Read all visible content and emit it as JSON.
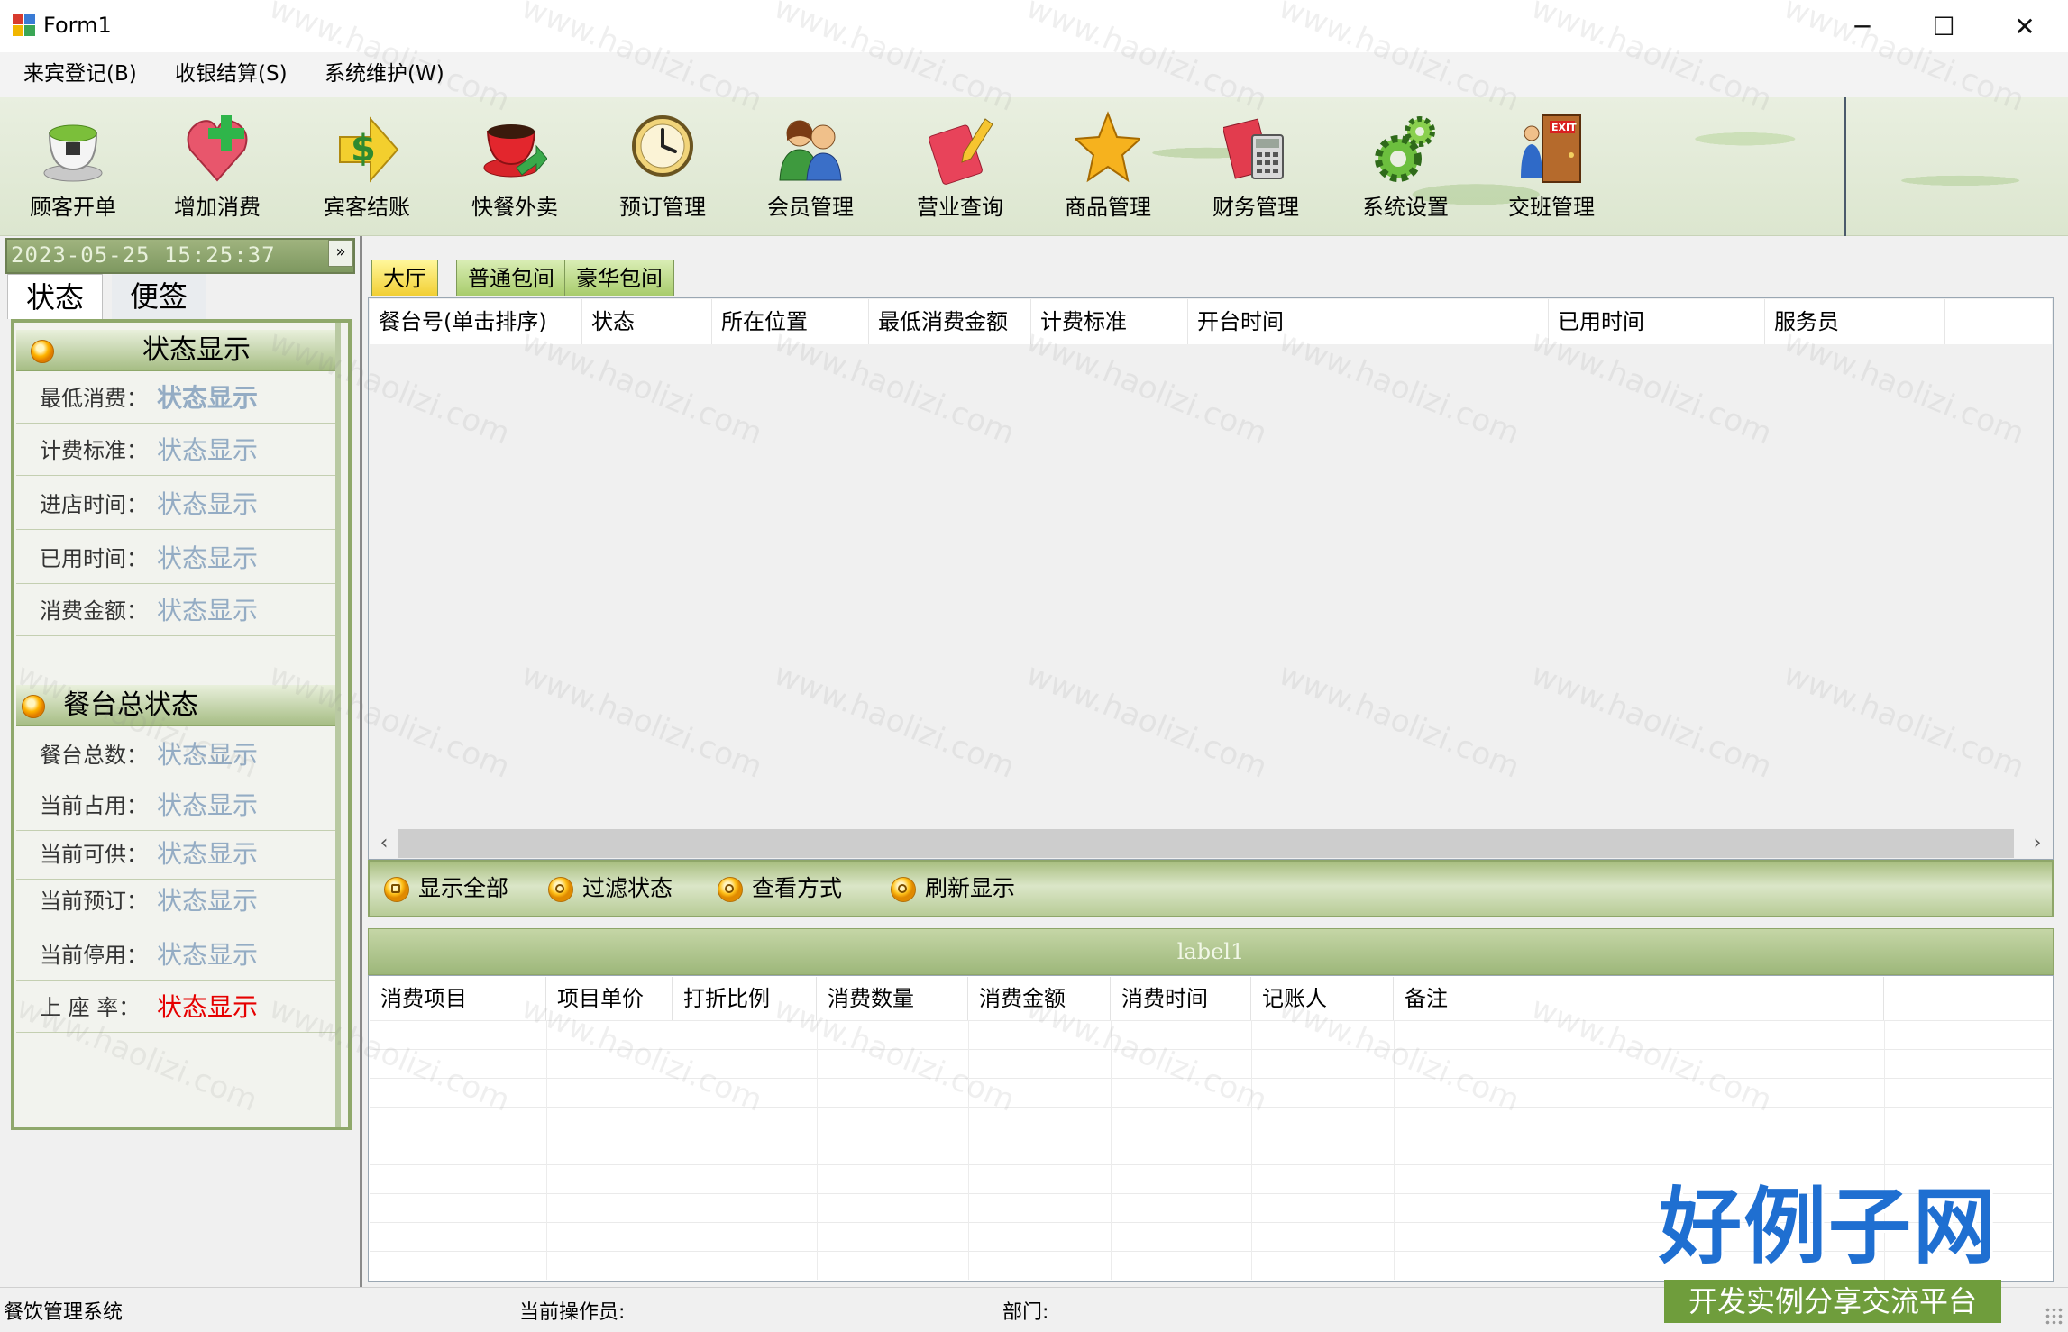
{
  "window": {
    "title": "Form1",
    "controls": [
      "─",
      "☐",
      "✕"
    ]
  },
  "menu": [
    {
      "label": "来宾登记(B)"
    },
    {
      "label": "收银结算(S)"
    },
    {
      "label": "系统维护(W)"
    }
  ],
  "toolbar": [
    {
      "label": "顾客开单",
      "icon": "teacup-icon"
    },
    {
      "label": "增加消费",
      "icon": "add-heart-icon"
    },
    {
      "label": "宾客结账",
      "icon": "dollar-arrow-icon"
    },
    {
      "label": "快餐外卖",
      "icon": "coffee-cup-icon"
    },
    {
      "label": "预订管理",
      "icon": "clock-icon"
    },
    {
      "label": "会员管理",
      "icon": "members-icon"
    },
    {
      "label": "营业查询",
      "icon": "notebook-pencil-icon"
    },
    {
      "label": "商品管理",
      "icon": "star-icon"
    },
    {
      "label": "财务管理",
      "icon": "calculator-icon"
    },
    {
      "label": "系统设置",
      "icon": "gears-icon"
    },
    {
      "label": "交班管理",
      "icon": "exit-door-icon"
    }
  ],
  "left_panel": {
    "datetime": "2023-05-25 15:25:37",
    "expand_label": "»",
    "tabs": [
      "状态",
      "便签"
    ],
    "status_section": {
      "title": "状态显示",
      "rows": [
        {
          "label": "最低消费：",
          "value": "状态显示"
        },
        {
          "label": "计费标准：",
          "value": "状态显示"
        },
        {
          "label": "进店时间：",
          "value": "状态显示"
        },
        {
          "label": "已用时间：",
          "value": "状态显示"
        },
        {
          "label": "消费金额：",
          "value": "状态显示"
        }
      ]
    },
    "table_section": {
      "title": "餐台总状态",
      "rows": [
        {
          "label": "餐台总数：",
          "value": "状态显示"
        },
        {
          "label": "当前占用：",
          "value": "状态显示"
        },
        {
          "label": "当前可供：",
          "value": "状态显示"
        },
        {
          "label": "当前预订：",
          "value": "状态显示"
        },
        {
          "label": "当前停用：",
          "value": "状态显示"
        },
        {
          "label": "上 座 率：",
          "value": "状态显示"
        }
      ]
    }
  },
  "room_tabs": [
    "大厅",
    "普通包间",
    "豪华包间"
  ],
  "table_grid": {
    "columns": [
      "餐台号(单击排序)",
      "状态",
      "所在位置",
      "最低消费金额",
      "计费标准",
      "开台时间",
      "已用时间",
      "服务员"
    ],
    "rows": []
  },
  "filter_buttons": [
    "显示全部",
    "过滤状态",
    "查看方式",
    "刷新显示"
  ],
  "detail_label": "label1",
  "detail_grid": {
    "columns": [
      "消费项目",
      "项目单价",
      "打折比例",
      "消费数量",
      "消费金额",
      "消费时间",
      "记账人",
      "备注"
    ],
    "rows": []
  },
  "statusbar": {
    "app_name": "餐饮管理系统",
    "operator_label": "当前操作员:",
    "department_label": "部门:"
  },
  "logo": {
    "main": "好例子网",
    "sub": "开发实例分享交流平台"
  },
  "watermark": "www.haolizi.com",
  "colors": {
    "panel_green": "#8fa86b",
    "status_value": "#94acc4",
    "occupancy_value": "#e60000",
    "logo_blue": "#1f6fd1",
    "logo_bar": "#6f9d3c"
  }
}
